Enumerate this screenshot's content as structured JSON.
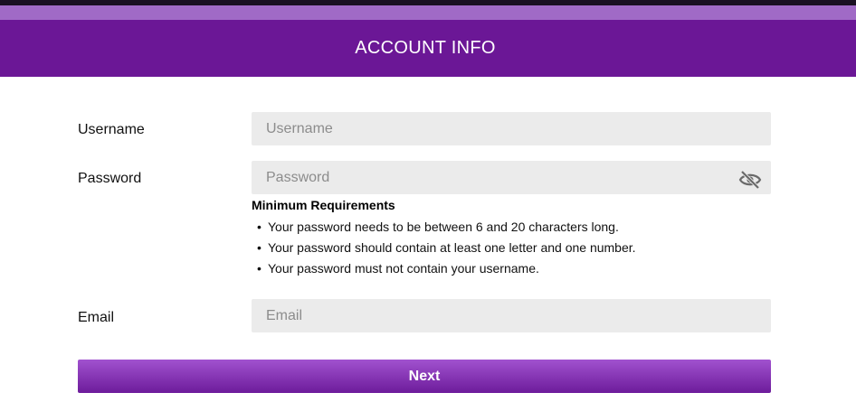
{
  "header": {
    "title": "ACCOUNT INFO"
  },
  "form": {
    "username": {
      "label": "Username",
      "placeholder": "Username",
      "value": ""
    },
    "password": {
      "label": "Password",
      "placeholder": "Password",
      "value": "",
      "toggle_icon": "eye-slash-icon"
    },
    "requirements": {
      "title": "Minimum Requirements",
      "items": [
        "Your password needs to be between 6 and 20 characters long.",
        "Your password should contain at least one letter and one number.",
        "Your password must not contain your username."
      ]
    },
    "email": {
      "label": "Email",
      "placeholder": "Email",
      "value": ""
    }
  },
  "actions": {
    "next_label": "Next"
  },
  "colors": {
    "header_bg": "#6b1796",
    "top_strip": "#a06ac6",
    "field_bg": "#ebebeb",
    "button_top": "#a152cf",
    "button_bottom": "#6d1c9b"
  }
}
